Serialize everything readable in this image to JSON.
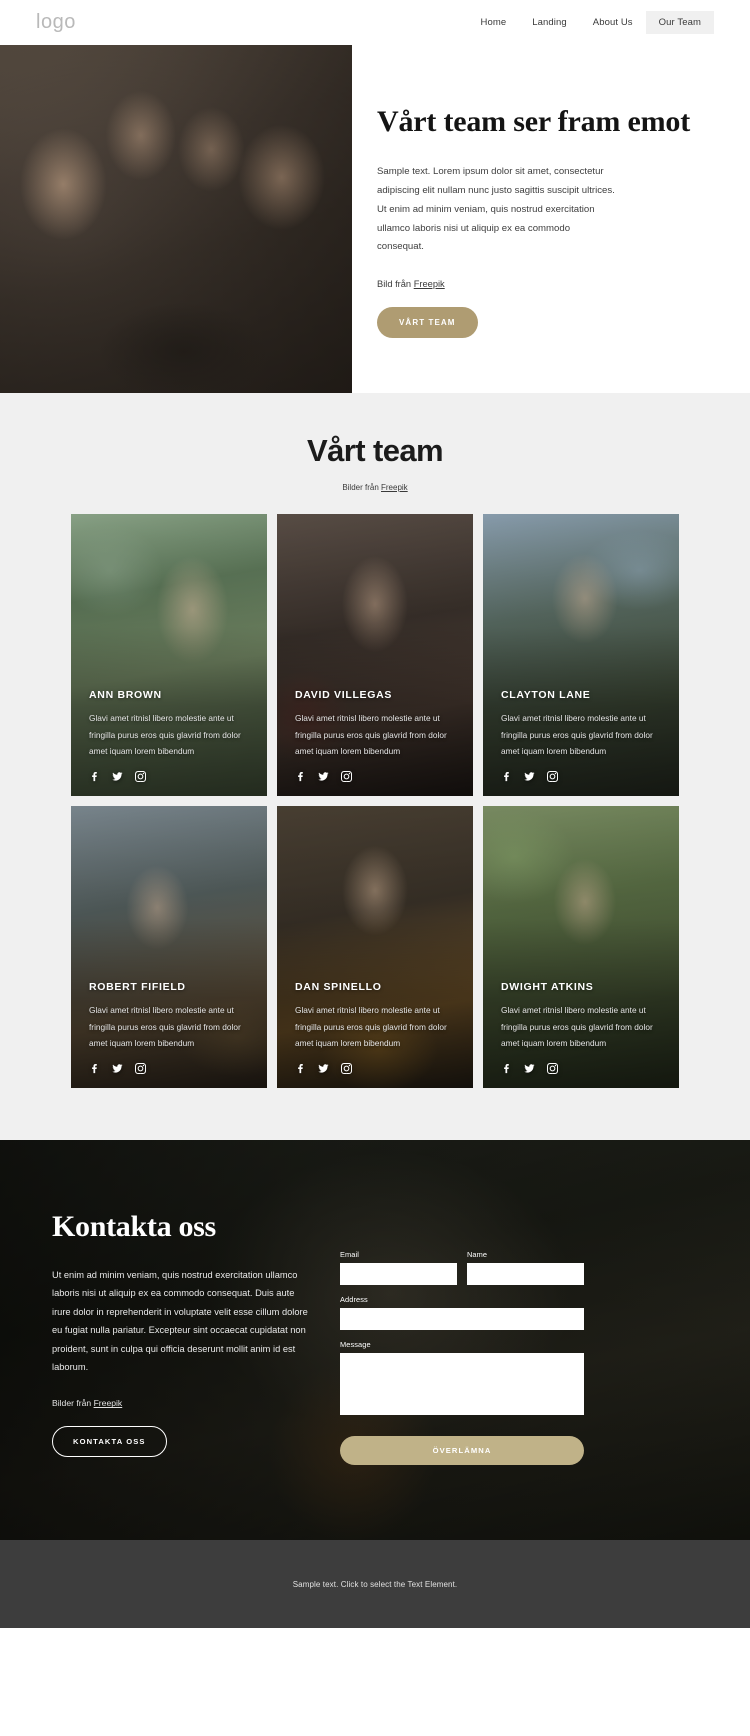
{
  "header": {
    "logo": "logo",
    "nav": [
      {
        "label": "Home",
        "active": false
      },
      {
        "label": "Landing",
        "active": false
      },
      {
        "label": "About Us",
        "active": false
      },
      {
        "label": "Our Team",
        "active": true
      }
    ]
  },
  "hero": {
    "title": "Vårt team ser fram emot",
    "body": "Sample text. Lorem ipsum dolor sit amet, consectetur adipiscing elit nullam nunc justo sagittis suscipit ultrices. Ut enim ad minim veniam, quis nostrud exercitation ullamco laboris nisi ut aliquip ex ea commodo consequat.",
    "credit_prefix": "Bild från ",
    "credit_link": "Freepik",
    "cta_label": "VÅRT TEAM"
  },
  "team": {
    "heading": "Vårt team",
    "credit_prefix": "Bilder från ",
    "credit_link": "Freepik",
    "member_desc": "Glavi amet ritnisl libero molestie ante ut fringilla purus eros quis glavrid from dolor amet iquam lorem bibendum",
    "social_icons": [
      "facebook-icon",
      "twitter-icon",
      "instagram-icon"
    ],
    "members": [
      {
        "name": "ANN BROWN"
      },
      {
        "name": "DAVID VILLEGAS"
      },
      {
        "name": "CLAYTON LANE"
      },
      {
        "name": "ROBERT FIFIELD"
      },
      {
        "name": "DAN SPINELLO"
      },
      {
        "name": "DWIGHT ATKINS"
      }
    ]
  },
  "contact": {
    "title": "Kontakta oss",
    "body": "Ut enim ad minim veniam, quis nostrud exercitation ullamco laboris nisi ut aliquip ex ea commodo consequat. Duis aute irure dolor in reprehenderit in voluptate velit esse cillum dolore eu fugiat nulla pariatur. Excepteur sint occaecat cupidatat non proident, sunt in culpa qui officia deserunt mollit anim id est laborum.",
    "credit_prefix": "Bilder från ",
    "credit_link": "Freepik",
    "cta_label": "KONTAKTA OSS",
    "form": {
      "email_label": "Email",
      "email_value": "",
      "name_label": "Name",
      "name_value": "",
      "address_label": "Address",
      "address_value": "",
      "message_label": "Message",
      "message_value": "",
      "submit_label": "ÖVERLÄMNA"
    }
  },
  "footer": {
    "text": "Sample text. Click to select the Text Element."
  },
  "colors": {
    "accent": "#af9c72",
    "submit": "#c0b288",
    "section_bg": "#f0f0f0",
    "footer_bg": "#3d3d3d"
  }
}
